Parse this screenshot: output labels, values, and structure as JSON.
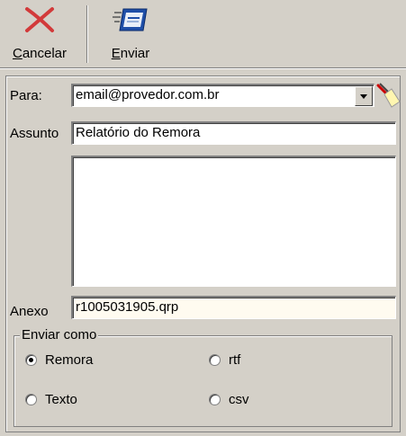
{
  "toolbar": {
    "cancel_label_u": "C",
    "cancel_label_rest": "ancelar",
    "send_label_u": "E",
    "send_label_rest": "nviar"
  },
  "form": {
    "to_label": "Para:",
    "to_value": "email@provedor.com.br",
    "subject_label": "Assunto",
    "subject_value": "Relatório do Remora",
    "body_value": "",
    "attachment_label": "Anexo",
    "attachment_value": "r1005031905.qrp"
  },
  "send_as": {
    "title": "Enviar como",
    "options": [
      {
        "label": "Remora",
        "selected": true
      },
      {
        "label": "rtf",
        "selected": false
      },
      {
        "label": "Texto",
        "selected": false
      },
      {
        "label": "csv",
        "selected": false
      }
    ]
  },
  "icons": {
    "cancel": "red-x-icon",
    "send": "send-mail-icon",
    "address_book": "flashlight-icon"
  }
}
